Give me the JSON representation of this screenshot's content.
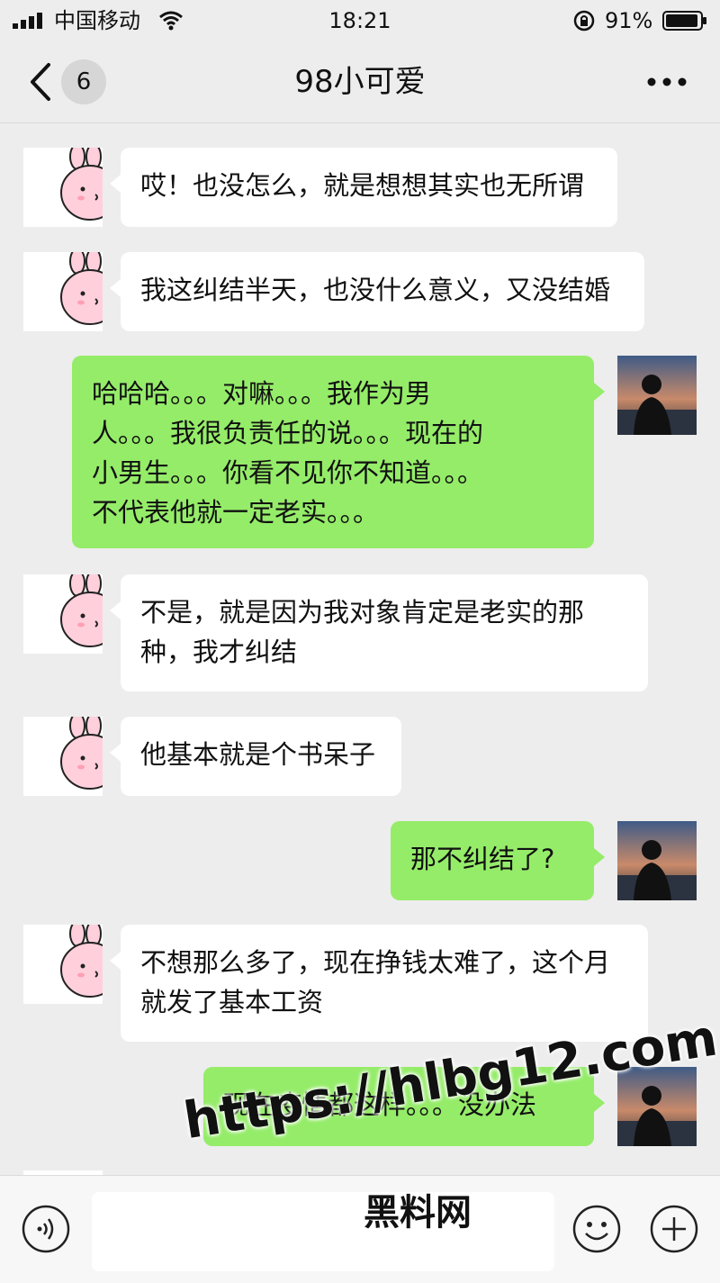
{
  "status_bar": {
    "carrier": "中国移动",
    "time": "18:21",
    "battery_percent": "91%"
  },
  "nav": {
    "unread_count": "6",
    "title": "98小可爱"
  },
  "messages": [
    {
      "side": "left",
      "text": "哎！也没怎么，就是想想其实也无所谓"
    },
    {
      "side": "left",
      "text": "我这纠结半天，也没什么意义，又没结婚"
    },
    {
      "side": "right",
      "text": "哈哈哈。。。对嘛。。。我作为男\n人。。。我很负责任的说。。。现在的\n小男生。。。你看不见你不知道。。。\n不代表他就一定老实。。。"
    },
    {
      "side": "left",
      "text": "不是，就是因为我对象肯定是老实的那\n种，我才纠结"
    },
    {
      "side": "left",
      "text": "他基本就是个书呆子"
    },
    {
      "side": "right",
      "text": "那不纠结了?"
    },
    {
      "side": "left",
      "text": "不想那么多了，现在挣钱太难了，这个月\n就发了基本工资"
    },
    {
      "side": "right",
      "text": "现在疫情都这样。。。没办法"
    }
  ],
  "watermark": {
    "url": "https://hlbg12.com",
    "name": "黑料网"
  },
  "icons": {
    "back": "chevron-left-icon",
    "more": "more-dots-icon",
    "voice": "voice-icon",
    "emoji": "emoji-icon",
    "plus": "plus-icon"
  },
  "colors": {
    "bubble_sent": "#95ec69",
    "bubble_received": "#ffffff",
    "background": "#ededed"
  }
}
